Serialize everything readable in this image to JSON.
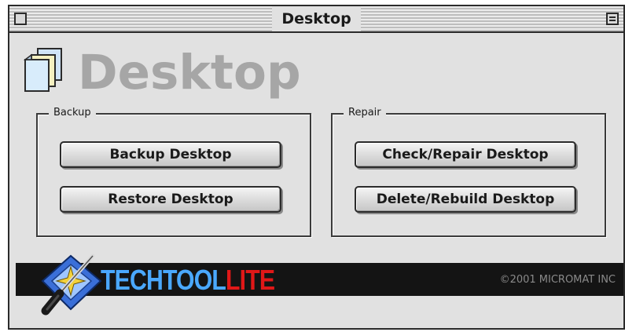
{
  "window": {
    "title": "Desktop"
  },
  "header": {
    "title": "Desktop",
    "icon": "desktop-folders-icon"
  },
  "groups": {
    "backup": {
      "label": "Backup",
      "buttons": [
        "Backup Desktop",
        "Restore Desktop"
      ]
    },
    "repair": {
      "label": "Repair",
      "buttons": [
        "Check/Repair Desktop",
        "Delete/Rebuild Desktop"
      ]
    }
  },
  "banner": {
    "brand_part1": "TECHTOOL",
    "brand_part2": "LITE",
    "copyright": "©2001 MICROMAT INC",
    "logo_icon": "techtool-screwdriver-logo-icon"
  },
  "colors": {
    "window_bg": "#e1e1e1",
    "banner_bg": "#141414",
    "brand_blue": "#4aa8ff",
    "brand_red": "#e01818",
    "header_text": "#a6a6a6"
  }
}
